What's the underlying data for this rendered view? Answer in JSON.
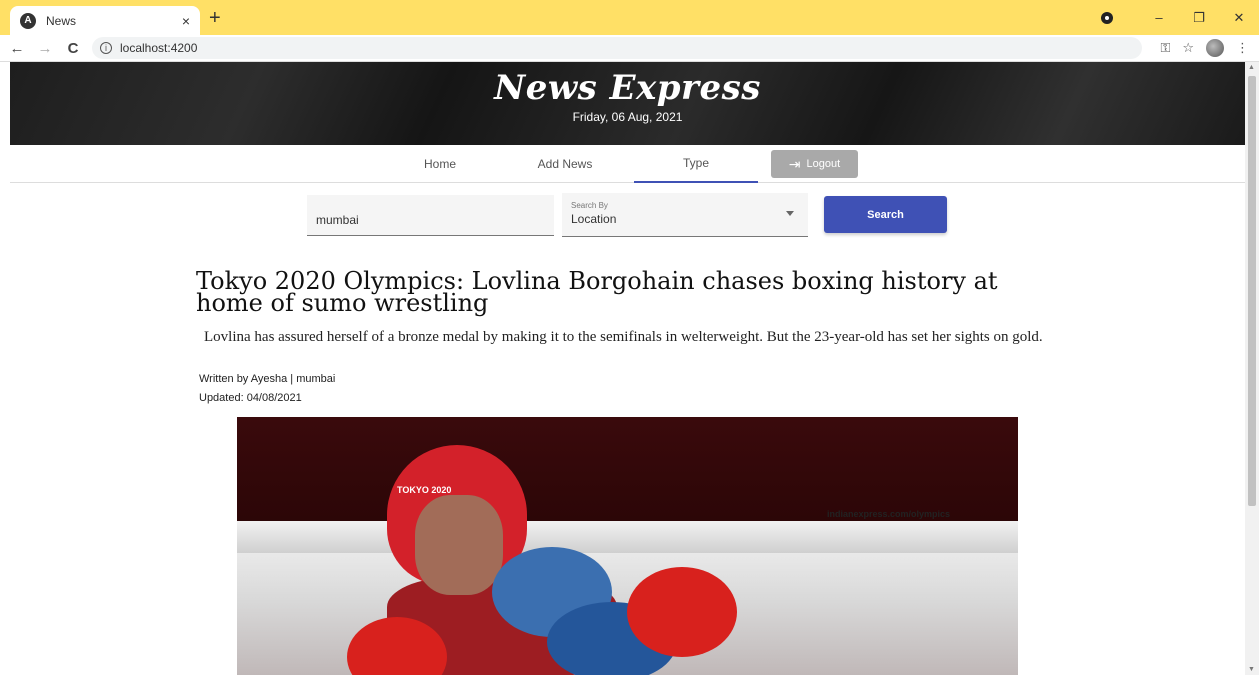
{
  "browser": {
    "tab_title": "News",
    "tab_close": "×",
    "new_tab": "+",
    "url": "localhost:4200",
    "nav_back": "←",
    "nav_forward": "→",
    "nav_reload": "C",
    "info": "i",
    "win_min": "–",
    "win_max": "❐",
    "win_close": "✕",
    "key_icon": "⚿",
    "star_icon": "☆",
    "menu_icon": "⋮"
  },
  "header": {
    "site_title": "News Express",
    "date": "Friday, 06 Aug, 2021"
  },
  "nav": {
    "items": [
      {
        "label": "Home",
        "active": false
      },
      {
        "label": "Add News",
        "active": false
      },
      {
        "label": "Type",
        "active": true
      }
    ],
    "logout_label": "Logout"
  },
  "search": {
    "value": "mumbai",
    "select_label": "Search By",
    "select_value": "Location",
    "button_label": "Search"
  },
  "article": {
    "headline": "Tokyo 2020 Olympics: Lovlina Borgohain chases boxing history at home of sumo wrestling",
    "summary": "Lovlina has assured herself of a bronze medal by making it to the semifinals in welterweight. But the 23-year-old has set her sights on gold.",
    "byline": "Written by Ayesha | mumbai",
    "updated": "Updated: 04/08/2021",
    "image_caption_url": "indianexpress.com/olympics",
    "helmet_text": "TOKYO 2020"
  }
}
